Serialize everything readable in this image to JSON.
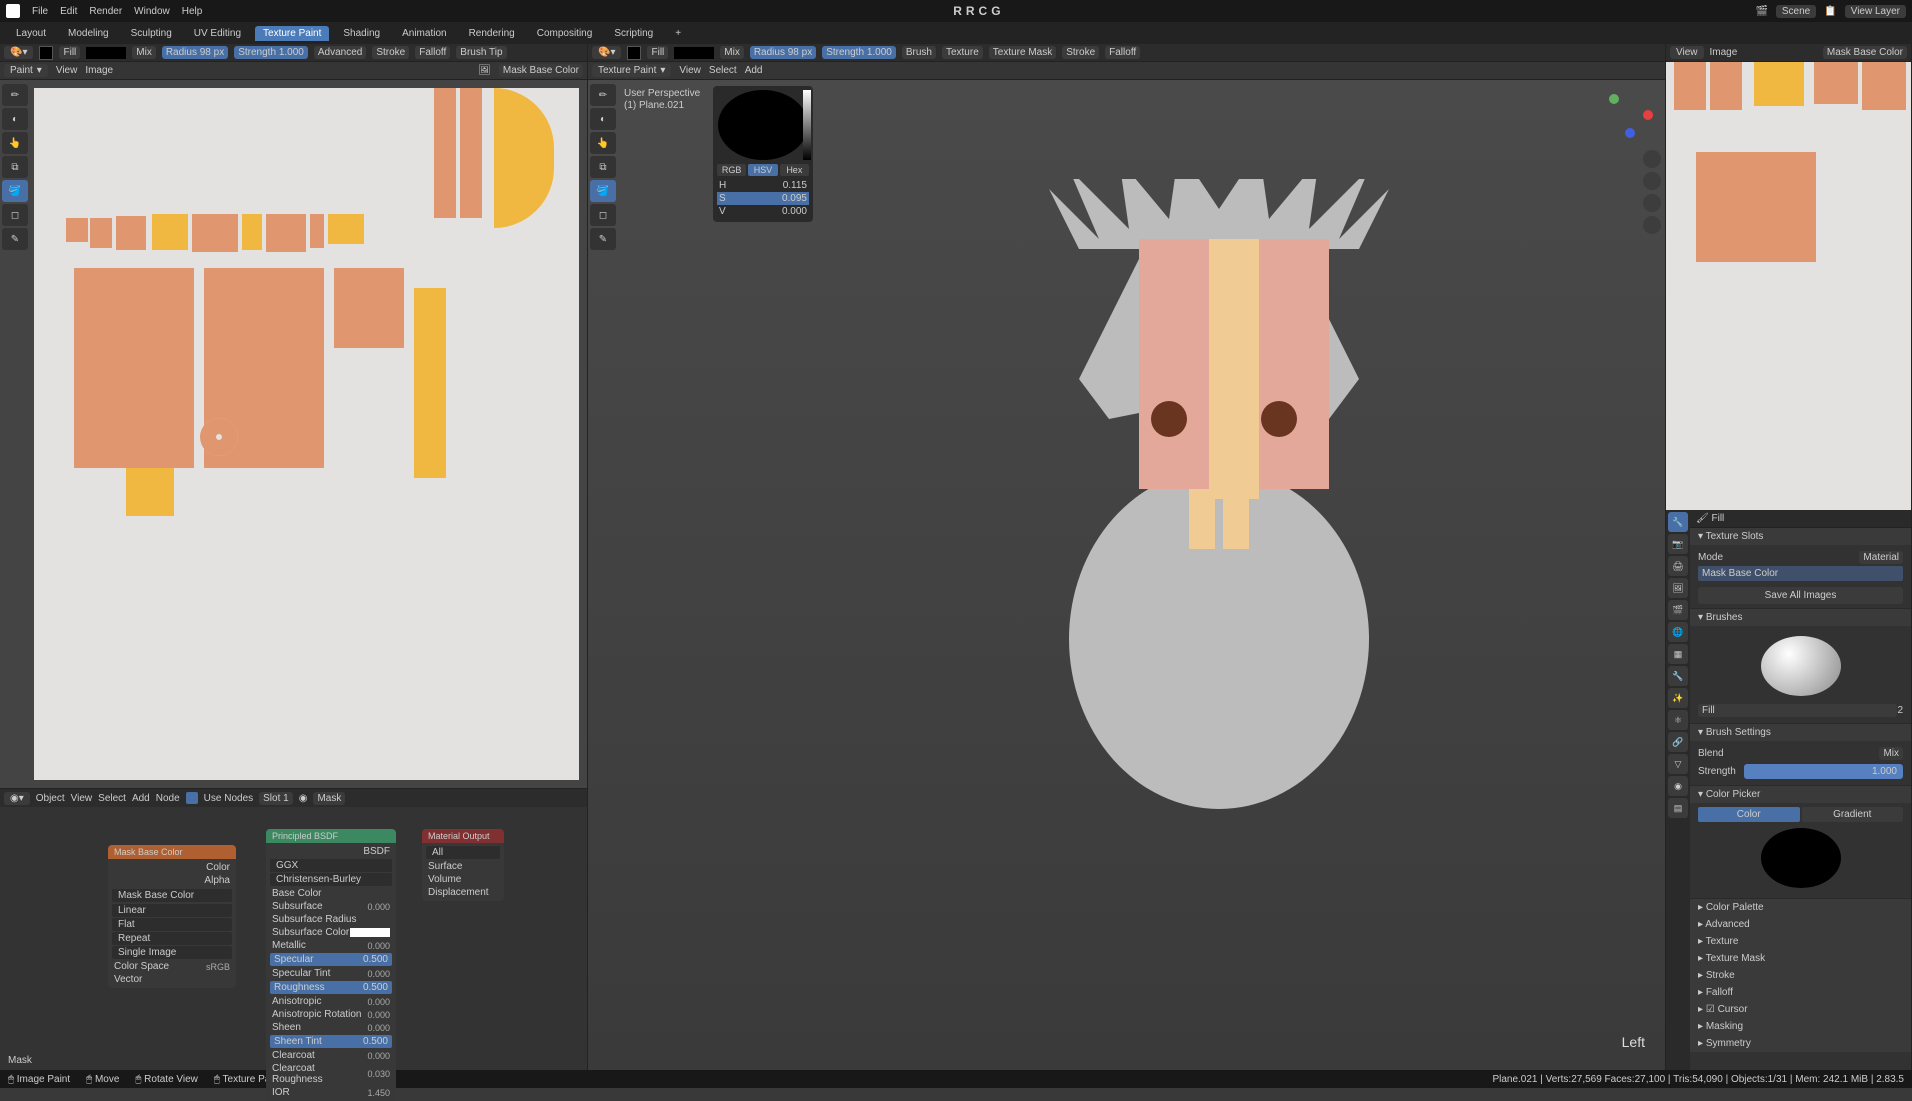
{
  "app": {
    "center_title": "RRCG",
    "menus": [
      "File",
      "Edit",
      "Render",
      "Window",
      "Help"
    ],
    "workspaces": [
      "Layout",
      "Modeling",
      "Sculpting",
      "UV Editing",
      "Texture Paint",
      "Shading",
      "Animation",
      "Rendering",
      "Compositing",
      "Scripting"
    ],
    "active_workspace": "Texture Paint",
    "scene_label": "Scene",
    "viewlayer_label": "View Layer"
  },
  "paint_header_left": {
    "fill_tool": "Fill",
    "mix_blend": "Mix",
    "radius_label": "Radius",
    "radius_val": "98 px",
    "strength_label": "Strength",
    "strength_val": "1.000",
    "advanced": "Advanced",
    "stroke": "Stroke",
    "falloff": "Falloff",
    "brushtip": "Brush Tip"
  },
  "paint_header_mid": {
    "fill_tool": "Fill",
    "mix_blend": "Mix",
    "radius_label": "Radius",
    "radius_val": "98 px",
    "strength_label": "Strength",
    "strength_val": "1.000",
    "brush": "Brush",
    "texture": "Texture",
    "texture_mask": "Texture Mask",
    "stroke": "Stroke",
    "falloff": "Falloff"
  },
  "uv_subheader": {
    "mode": "Paint",
    "menus": [
      "View",
      "Image"
    ],
    "image_name": "Mask Base Color"
  },
  "viewport_subheader": {
    "mode": "Texture Paint",
    "menus": [
      "View",
      "Select",
      "Add"
    ]
  },
  "viewport3d": {
    "perspective": "User Perspective",
    "object": "(1) Plane.021",
    "orientation": "Left"
  },
  "color_picker": {
    "tabs": [
      "RGB",
      "HSV",
      "Hex"
    ],
    "active_tab": "HSV",
    "rows": [
      {
        "label": "H",
        "value": "0.115"
      },
      {
        "label": "S",
        "value": "0.095"
      },
      {
        "label": "V",
        "value": "0.000"
      }
    ]
  },
  "right_img_header": {
    "menus": [
      "View",
      "Image"
    ],
    "image_name": "Mask Base Color"
  },
  "node_editor": {
    "menus": [
      "Object",
      "View",
      "Select",
      "Add",
      "Node"
    ],
    "use_nodes": "Use Nodes",
    "slot": "Slot 1",
    "material": "Mask",
    "footer": "Mask"
  },
  "node_image": {
    "title": "Mask Base Color",
    "outputs": [
      "Color",
      "Alpha"
    ],
    "image_name": "Mask Base Color",
    "interp": "Linear",
    "projection": "Flat",
    "extension": "Repeat",
    "source": "Single Image",
    "color_space_label": "Color Space",
    "color_space": "sRGB",
    "vector": "Vector"
  },
  "node_bsdf": {
    "title": "Principled BSDF",
    "out": "BSDF",
    "dist": "GGX",
    "sss": "Christensen-Burley",
    "props": [
      {
        "name": "Base Color",
        "value": "",
        "slider": false
      },
      {
        "name": "Subsurface",
        "value": "0.000",
        "slider": false
      },
      {
        "name": "Subsurface Radius",
        "value": "",
        "slider": false
      },
      {
        "name": "Subsurface Color",
        "value": "",
        "slider": false
      },
      {
        "name": "Metallic",
        "value": "0.000",
        "slider": false
      },
      {
        "name": "Specular",
        "value": "0.500",
        "slider": true
      },
      {
        "name": "Specular Tint",
        "value": "0.000",
        "slider": false
      },
      {
        "name": "Roughness",
        "value": "0.500",
        "slider": true
      },
      {
        "name": "Anisotropic",
        "value": "0.000",
        "slider": false
      },
      {
        "name": "Anisotropic Rotation",
        "value": "0.000",
        "slider": false
      },
      {
        "name": "Sheen",
        "value": "0.000",
        "slider": false
      },
      {
        "name": "Sheen Tint",
        "value": "0.500",
        "slider": true
      },
      {
        "name": "Clearcoat",
        "value": "0.000",
        "slider": false
      },
      {
        "name": "Clearcoat Roughness",
        "value": "0.030",
        "slider": false
      },
      {
        "name": "IOR",
        "value": "1.450",
        "slider": false
      }
    ]
  },
  "node_output": {
    "title": "Material Output",
    "target": "All",
    "inputs": [
      "Surface",
      "Volume",
      "Displacement"
    ]
  },
  "props": {
    "fill_name": "Fill",
    "texture_slots": "Texture Slots",
    "mode_label": "Mode",
    "material_label": "Material",
    "slot_item": "Mask Base Color",
    "save_all": "Save All Images",
    "brushes": "Brushes",
    "brush_name": "Fill",
    "brush_count": "2",
    "brush_settings": "Brush Settings",
    "blend_label": "Blend",
    "blend_val": "Mix",
    "strength_label": "Strength",
    "strength_val": "1.000",
    "color_picker": "Color Picker",
    "color_btn": "Color",
    "gradient_btn": "Gradient",
    "sections": [
      "Color Palette",
      "Advanced",
      "Texture",
      "Texture Mask",
      "Stroke",
      "Falloff",
      "Cursor",
      "Masking",
      "Symmetry"
    ]
  },
  "statusbar": {
    "hints": [
      {
        "icon": "●",
        "label": "Image Paint"
      },
      {
        "icon": "●",
        "label": "Move"
      },
      {
        "icon": "●",
        "label": "Rotate View"
      },
      {
        "icon": "●",
        "label": "Texture Paint Context Menu"
      }
    ],
    "right": "Plane.021 | Verts:27,569  Faces:27,100 | Tris:54,090 | Objects:1/31 | Mem: 242.1 MiB | 2.83.5"
  }
}
